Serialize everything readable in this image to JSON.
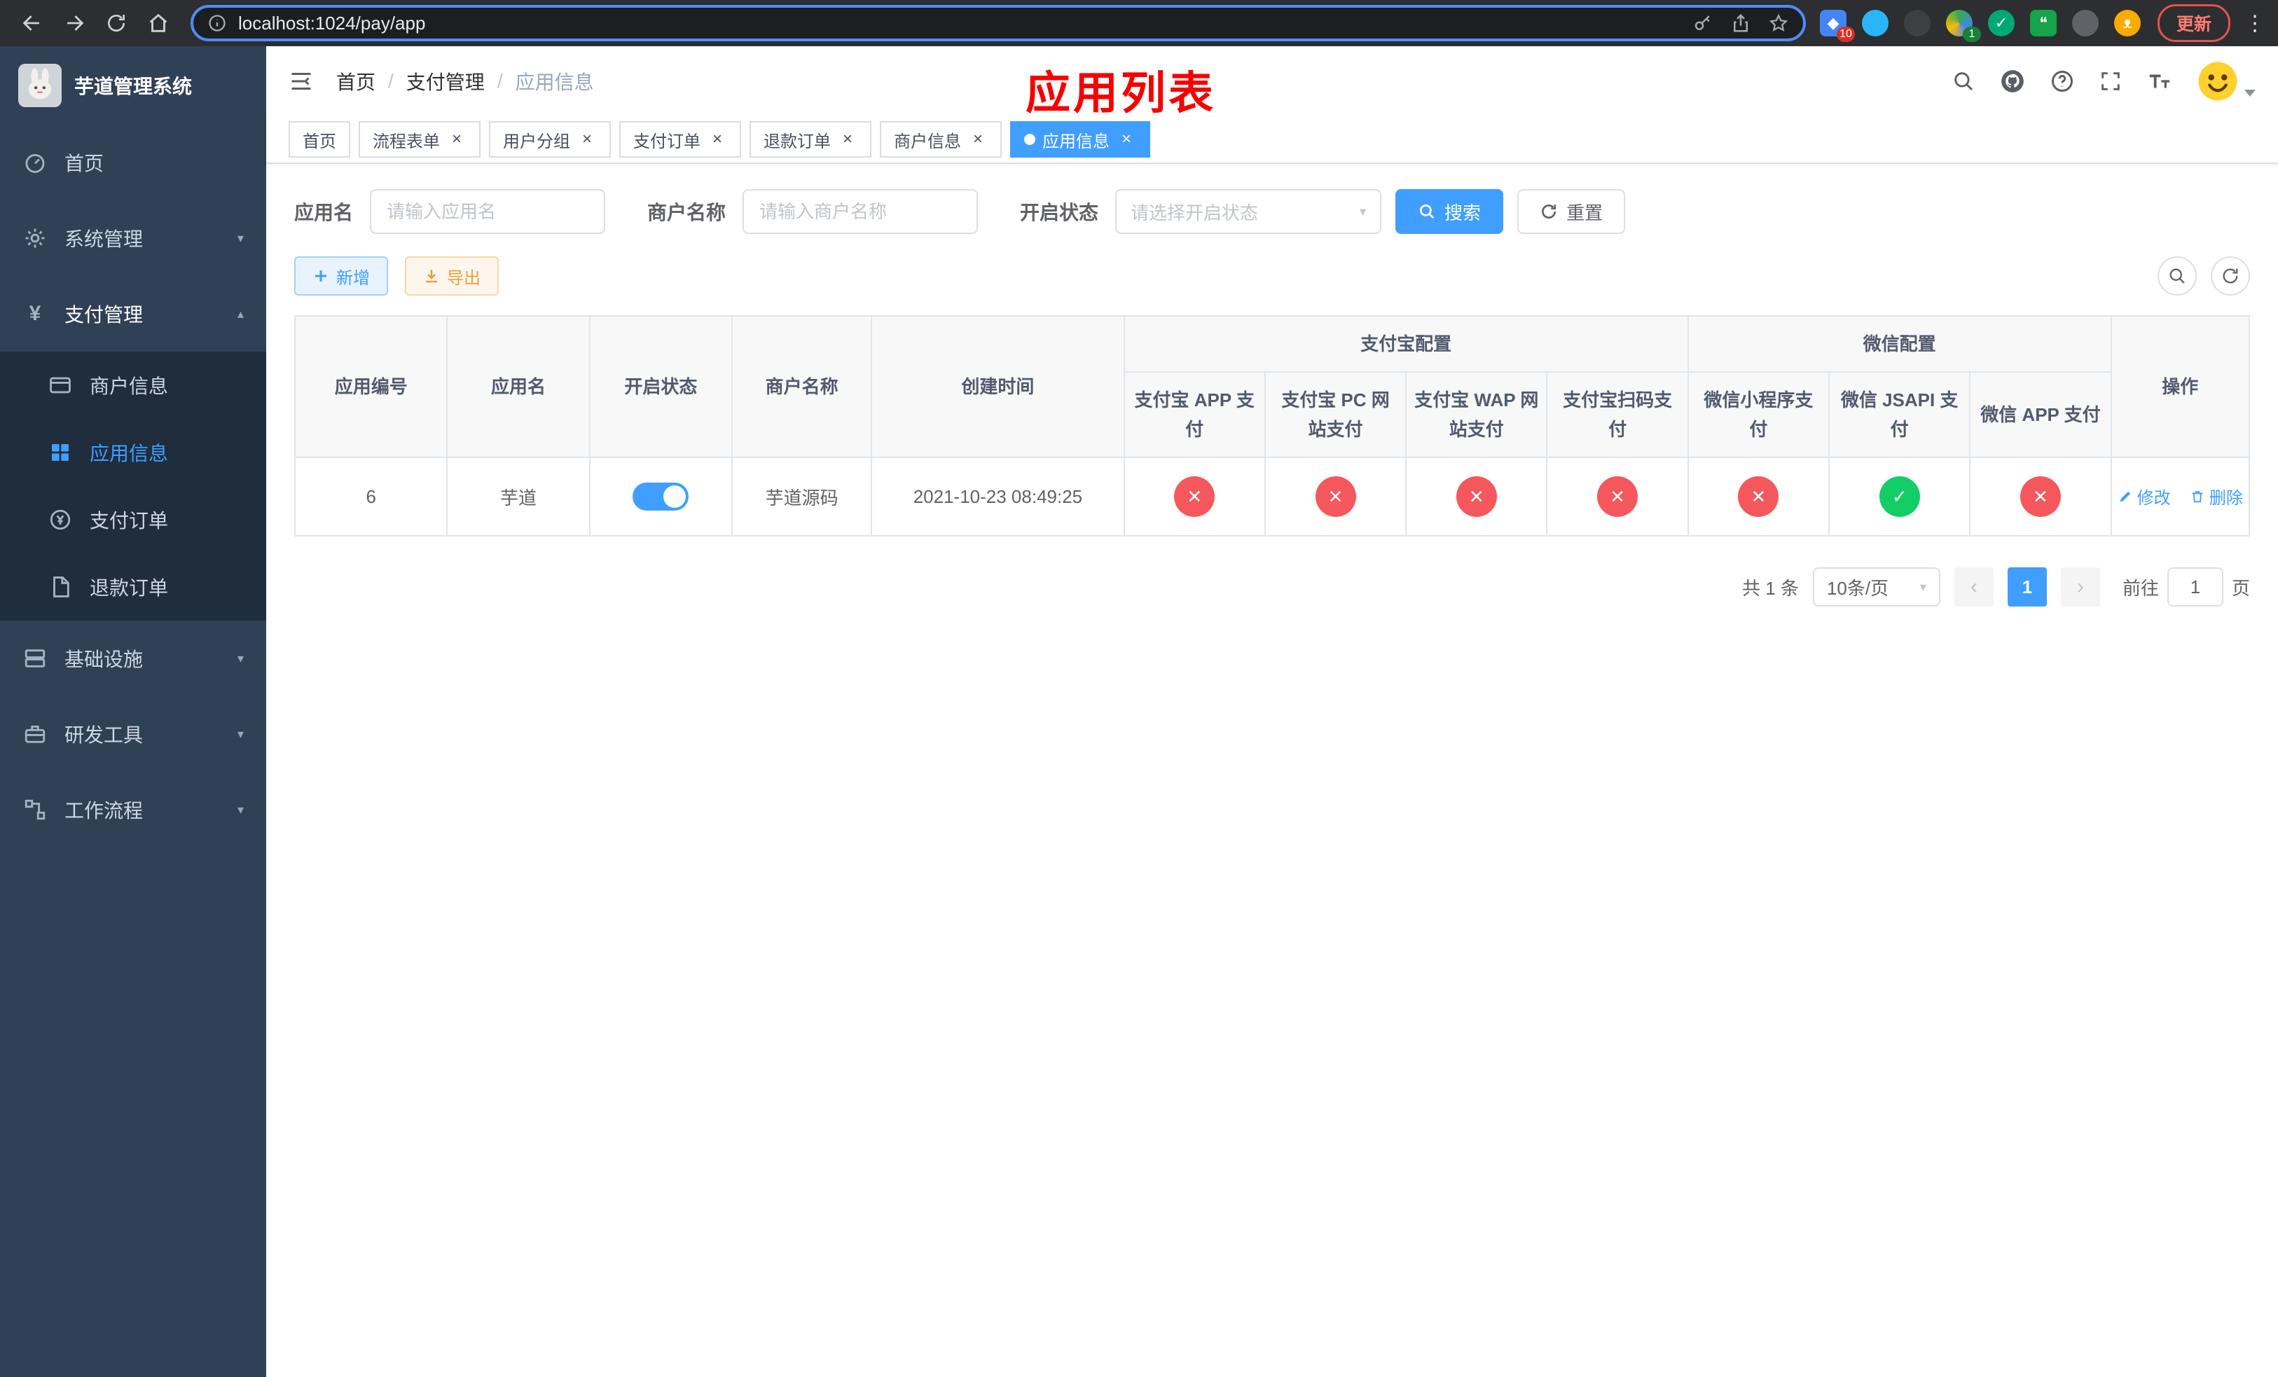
{
  "browser": {
    "url": "localhost:1024/pay/app",
    "update_label": "更新",
    "extensions": {
      "badge_blue": "10",
      "badge_colorful": "1"
    }
  },
  "sidebar": {
    "app_title": "芋道管理系统",
    "items": {
      "home": "首页",
      "system": "系统管理",
      "payment": "支付管理",
      "infra": "基础设施",
      "devtools": "研发工具",
      "workflow": "工作流程"
    },
    "payment_children": {
      "merchant": "商户信息",
      "app": "应用信息",
      "order": "支付订单",
      "refund": "退款订单"
    }
  },
  "header": {
    "breadcrumb": {
      "home": "首页",
      "section": "支付管理",
      "page": "应用信息"
    },
    "annotation": "应用列表"
  },
  "tabs": [
    {
      "label": "首页",
      "closable": false,
      "active": false
    },
    {
      "label": "流程表单",
      "closable": true,
      "active": false
    },
    {
      "label": "用户分组",
      "closable": true,
      "active": false
    },
    {
      "label": "支付订单",
      "closable": true,
      "active": false
    },
    {
      "label": "退款订单",
      "closable": true,
      "active": false
    },
    {
      "label": "商户信息",
      "closable": true,
      "active": false
    },
    {
      "label": "应用信息",
      "closable": true,
      "active": true
    }
  ],
  "filters": {
    "app_name": {
      "label": "应用名",
      "placeholder": "请输入应用名",
      "value": ""
    },
    "merchant_name": {
      "label": "商户名称",
      "placeholder": "请输入商户名称",
      "value": ""
    },
    "status": {
      "label": "开启状态",
      "placeholder": "请选择开启状态",
      "value": ""
    },
    "search_label": "搜索",
    "reset_label": "重置"
  },
  "toolbar": {
    "add_label": "新增",
    "export_label": "导出"
  },
  "table": {
    "columns": {
      "id": "应用编号",
      "name": "应用名",
      "status": "开启状态",
      "merchant": "商户名称",
      "created": "创建时间",
      "alipay_group": "支付宝配置",
      "wechat_group": "微信配置",
      "alipay": [
        "支付宝 APP 支付",
        "支付宝 PC 网站支付",
        "支付宝 WAP 网站支付",
        "支付宝扫码支付"
      ],
      "wechat": [
        "微信小程序支付",
        "微信 JSAPI 支付",
        "微信 APP 支付"
      ],
      "actions": "操作"
    },
    "rows": [
      {
        "id": "6",
        "name": "芋道",
        "enabled": true,
        "merchant": "芋道源码",
        "created": "2021-10-23 08:49:25",
        "configs": [
          false,
          false,
          false,
          false,
          false,
          true,
          false
        ],
        "edit_label": "修改",
        "delete_label": "删除"
      }
    ]
  },
  "pagination": {
    "total": "共 1 条",
    "page_size": "10条/页",
    "page": "1",
    "goto_label": "前往",
    "goto_value": "1",
    "page_unit": "页"
  },
  "colors": {
    "primary": "#409eff",
    "danger": "#f5585c",
    "success": "#13ce66",
    "warning": "#e6a23c",
    "annotation": "#f70000"
  }
}
